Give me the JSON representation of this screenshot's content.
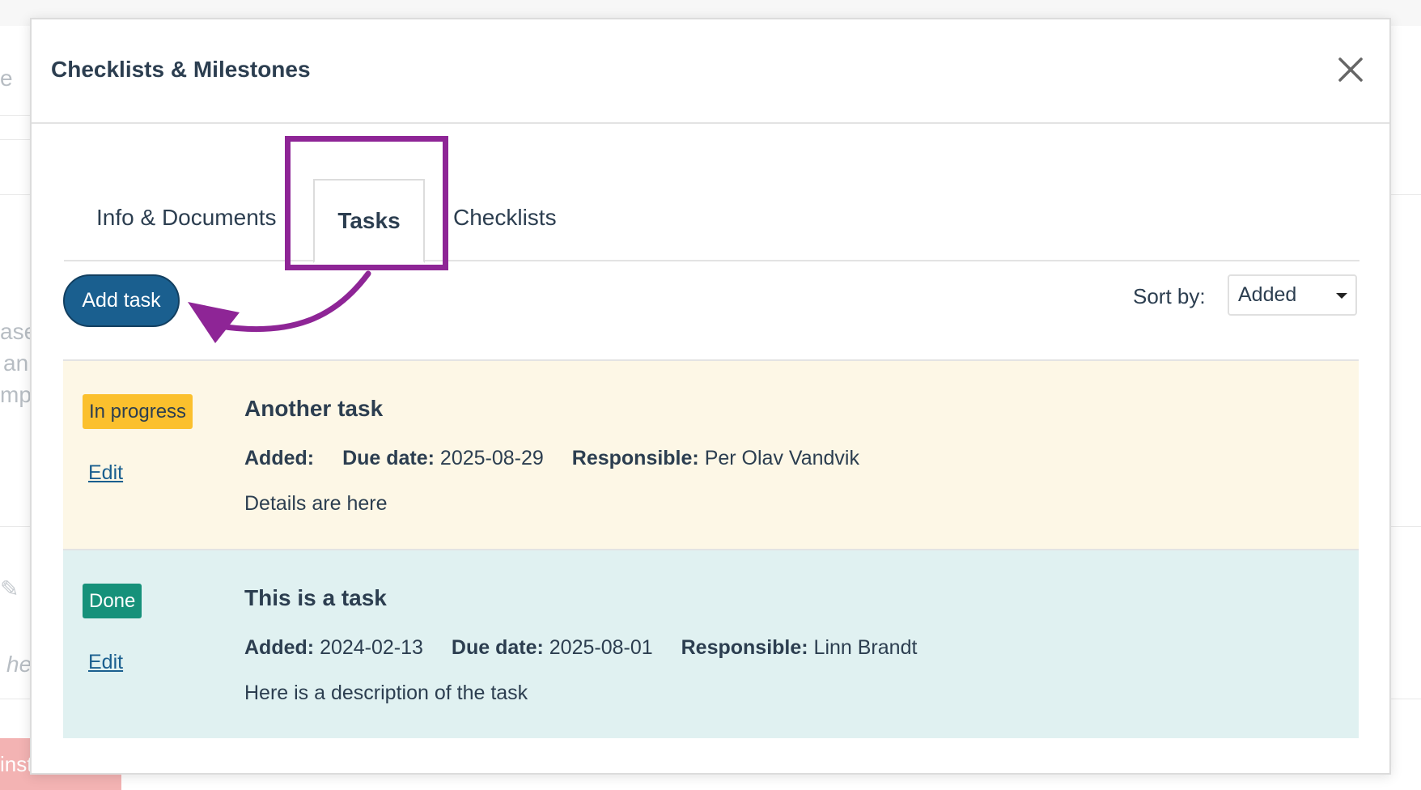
{
  "background": {
    "fragments": [
      "e",
      "ase",
      "an",
      "mpt",
      "he",
      "inst"
    ]
  },
  "modal": {
    "title": "Checklists & Milestones",
    "close_icon": "close-icon"
  },
  "tabs": [
    {
      "label": "Info & Documents",
      "active": false
    },
    {
      "label": "Tasks",
      "active": true
    },
    {
      "label": "Checklists",
      "active": false
    }
  ],
  "toolbar": {
    "add_task_label": "Add task",
    "sort_label": "Sort by:",
    "sort_value": "Added"
  },
  "tasks": [
    {
      "status": "In progress",
      "edit_label": "Edit",
      "title": "Another task",
      "added_label": "Added:",
      "added_value": "",
      "due_label": "Due date:",
      "due_value": "2025-08-29",
      "responsible_label": "Responsible:",
      "responsible_value": "Per Olav Vandvik",
      "description": "Details are here"
    },
    {
      "status": "Done",
      "edit_label": "Edit",
      "title": "This is a task",
      "added_label": "Added:",
      "added_value": "2024-02-13",
      "due_label": "Due date:",
      "due_value": "2025-08-01",
      "responsible_label": "Responsible:",
      "responsible_value": "Linn Brandt",
      "description": "Here is a description of the task"
    }
  ],
  "colors": {
    "primary": "#1a5f8f",
    "highlight": "#8e2596",
    "in_progress_badge": "#fbc02d",
    "done_badge": "#16917a",
    "in_progress_row": "#fdf7e6",
    "done_row": "#e0f1f1"
  }
}
